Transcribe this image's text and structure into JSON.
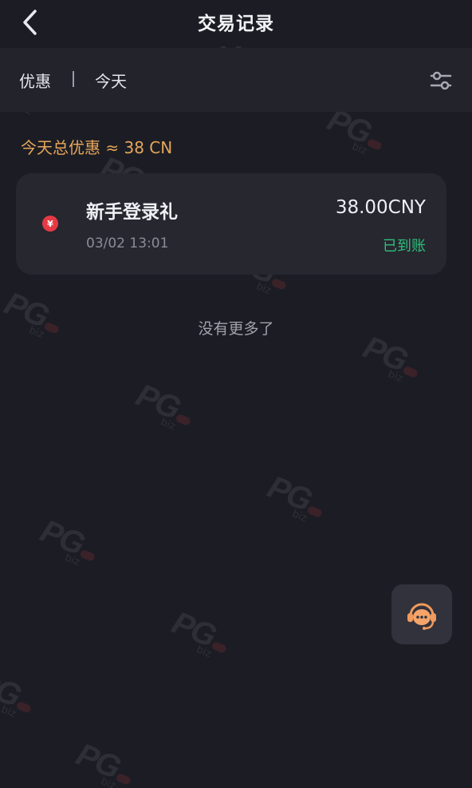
{
  "header": {
    "title": "交易记录",
    "back_icon": "chevron-left-icon"
  },
  "filter_bar": {
    "type_label": "优惠",
    "separator": "|",
    "date_label": "今天",
    "settings_icon": "sliders-icon"
  },
  "summary": {
    "text": "今天总优惠 ≈ 38 CN"
  },
  "transactions": [
    {
      "icon": "yuan-coin-icon",
      "icon_text": "¥",
      "title": "新手登录礼",
      "amount": "38.00CNY",
      "time": "03/02 13:01",
      "status": "已到账"
    }
  ],
  "list_footer": {
    "no_more_text": "没有更多了"
  },
  "support": {
    "icon": "customer-service-icon"
  },
  "watermark": {
    "text": "PG",
    "sub": "biz"
  },
  "colors": {
    "background": "#1c1d24",
    "filter_bar": "#22232b",
    "card": "#26272f",
    "accent_orange": "#e6a55a",
    "success_green": "#2fc07d",
    "coin_red": "#e53a45"
  }
}
